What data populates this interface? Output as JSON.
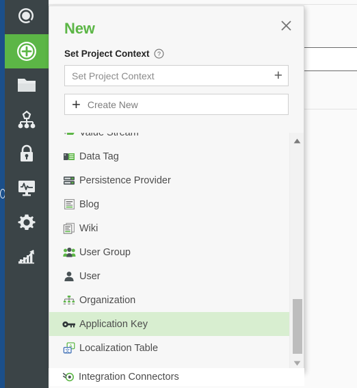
{
  "window": {
    "accent_blue": "#1b4f8a",
    "rail_bg": "#3b4447",
    "brand_green": "#5cb646",
    "selection_green": "#d8eed0"
  },
  "rail": {
    "items": [
      {
        "name": "search-icon",
        "label": "Search",
        "active": false
      },
      {
        "name": "add-icon",
        "label": "New",
        "active": true
      },
      {
        "name": "folder-icon",
        "label": "Projects",
        "active": false
      },
      {
        "name": "hierarchy-icon",
        "label": "Hierarchy",
        "active": false
      },
      {
        "name": "lock-icon",
        "label": "Security",
        "active": false
      },
      {
        "name": "monitor-pulse-icon",
        "label": "Monitoring",
        "active": false
      },
      {
        "name": "gear-icon",
        "label": "Settings",
        "active": false
      },
      {
        "name": "chart-growth-icon",
        "label": "Analytics",
        "active": false
      }
    ]
  },
  "panel": {
    "title": "New",
    "close_label": "×",
    "context_label": "Set Project Context",
    "context_help_glyph": "?",
    "context_input": {
      "value": "",
      "placeholder": "Set Project Context",
      "add_glyph": "+"
    },
    "create_new": {
      "plus_glyph": "+",
      "label": "Create New"
    },
    "list": [
      {
        "label": "Value Stream",
        "icon": "value-stream-icon",
        "selected": false
      },
      {
        "label": "Data Tag",
        "icon": "data-tag-icon",
        "selected": false
      },
      {
        "label": "Persistence Provider",
        "icon": "persistence-provider-icon",
        "selected": false
      },
      {
        "label": "Blog",
        "icon": "blog-icon",
        "selected": false
      },
      {
        "label": "Wiki",
        "icon": "wiki-icon",
        "selected": false
      },
      {
        "label": "User Group",
        "icon": "user-group-icon",
        "selected": false
      },
      {
        "label": "User",
        "icon": "user-icon",
        "selected": false
      },
      {
        "label": "Organization",
        "icon": "organization-icon",
        "selected": false
      },
      {
        "label": "Application Key",
        "icon": "key-icon",
        "selected": true
      },
      {
        "label": "Localization Table",
        "icon": "localization-table-icon",
        "selected": false
      }
    ],
    "overflow_item": {
      "label": "Integration Connectors",
      "icon": "integration-connectors-icon"
    },
    "scrollbar": {
      "up_glyph": "▲",
      "down_glyph": "▼"
    }
  }
}
